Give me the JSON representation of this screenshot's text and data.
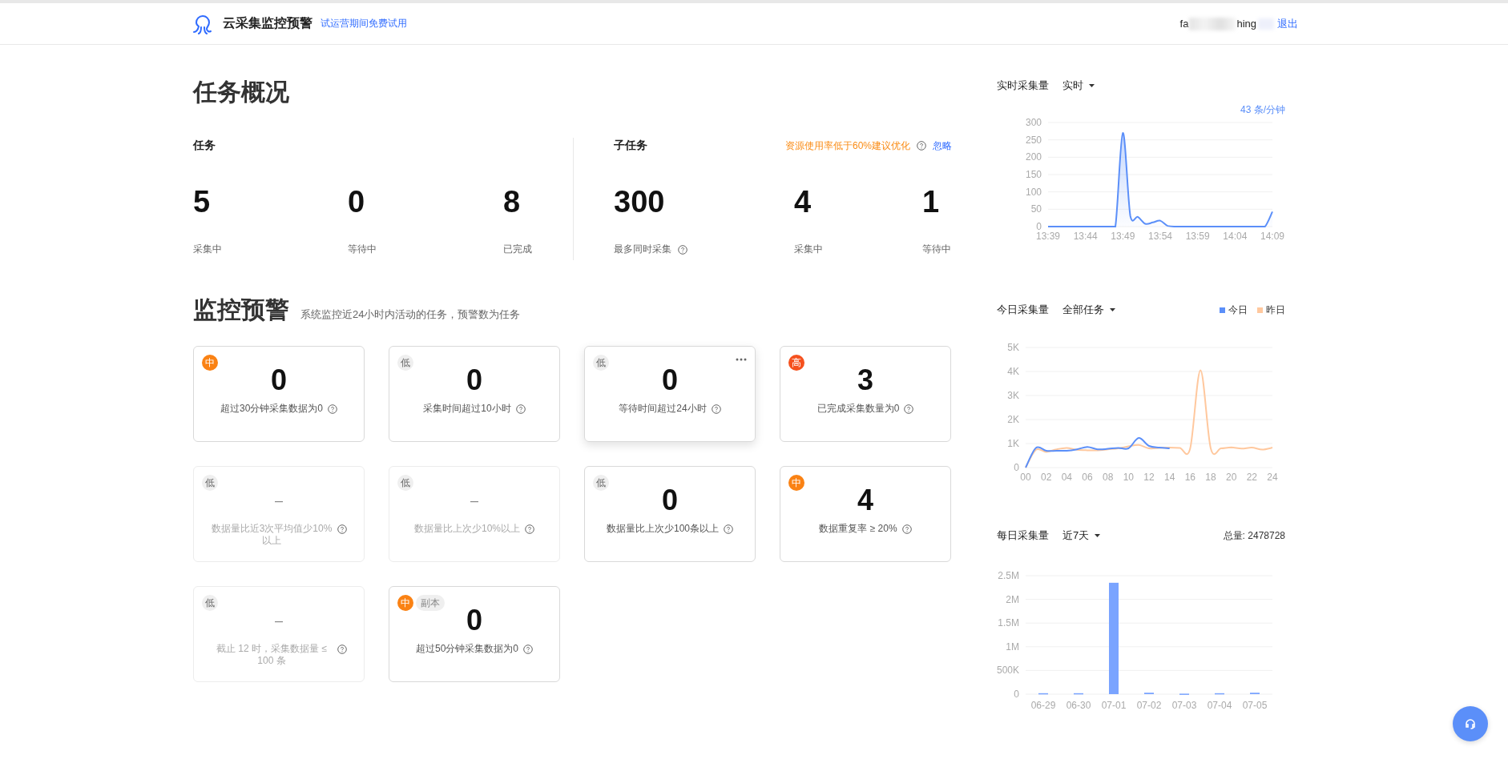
{
  "header": {
    "title": "云采集监控预警",
    "trial_note": "试运营期间免费试用",
    "username_start": "fa",
    "username_end": "hing",
    "logout": "退出"
  },
  "overview": {
    "title": "任务概况",
    "tasks": {
      "label": "任务",
      "stats": [
        {
          "value": "5",
          "label": "采集中",
          "help": false
        },
        {
          "value": "0",
          "label": "等待中",
          "help": false
        },
        {
          "value": "8",
          "label": "已完成",
          "help": false
        }
      ]
    },
    "subtasks": {
      "label": "子任务",
      "notice": "资源使用率低于60%建议优化",
      "ignore": "忽略",
      "stats": [
        {
          "value": "300",
          "label": "最多同时采集",
          "help": true
        },
        {
          "value": "4",
          "label": "采集中",
          "help": false
        },
        {
          "value": "1",
          "label": "等待中",
          "help": false
        }
      ]
    }
  },
  "monitor": {
    "title": "监控预警",
    "subtitle": "系统监控近24小时内活动的任务，预警数为任务",
    "cards": [
      {
        "severity": "中",
        "kind": "medium",
        "value": "0",
        "desc": "超过30分钟采集数据为0",
        "disabled": false,
        "hovered": false
      },
      {
        "severity": "低",
        "kind": "low",
        "value": "0",
        "desc": "采集时间超过10小时",
        "disabled": false,
        "hovered": false
      },
      {
        "severity": "低",
        "kind": "low",
        "value": "0",
        "desc": "等待时间超过24小时",
        "disabled": false,
        "hovered": true
      },
      {
        "severity": "高",
        "kind": "high",
        "value": "3",
        "desc": "已完成采集数量为0",
        "disabled": false,
        "hovered": false
      },
      {
        "severity": "低",
        "kind": "low",
        "value": "–",
        "desc": "数据量比近3次平均值少10%以上",
        "disabled": true,
        "hovered": false
      },
      {
        "severity": "低",
        "kind": "low",
        "value": "–",
        "desc": "数据量比上次少10%以上",
        "disabled": true,
        "hovered": false
      },
      {
        "severity": "低",
        "kind": "low",
        "value": "0",
        "desc": "数据量比上次少100条以上",
        "disabled": false,
        "hovered": false
      },
      {
        "severity": "中",
        "kind": "medium",
        "value": "4",
        "desc": "数据重复率 ≥ 20%",
        "disabled": false,
        "hovered": false
      },
      {
        "severity": "低",
        "kind": "low",
        "value": "–",
        "desc": "截止 12 时，采集数据量 ≤ 100 条",
        "disabled": true,
        "hovered": false
      },
      {
        "severity": "中",
        "kind": "medium",
        "tag": "副本",
        "value": "0",
        "desc": "超过50分钟采集数据为0",
        "disabled": false,
        "hovered": false
      }
    ]
  },
  "realtime": {
    "title": "实时采集量",
    "filter": "实时",
    "rate": "43 条/分钟",
    "chart_data": {
      "type": "area",
      "categories": [
        "13:39",
        null,
        null,
        null,
        null,
        "13:44",
        null,
        null,
        null,
        null,
        "13:49",
        null,
        null,
        null,
        null,
        "13:54",
        null,
        null,
        null,
        null,
        "13:59",
        null,
        null,
        null,
        null,
        "14:04",
        null,
        null,
        null,
        null,
        "14:09"
      ],
      "series": [
        {
          "color": "#5b8ff9",
          "values": [
            0,
            0,
            0,
            0,
            0,
            0,
            0,
            0,
            0,
            0,
            270,
            30,
            28,
            8,
            12,
            17,
            2,
            0,
            0,
            0,
            0,
            0,
            0,
            0,
            0,
            0,
            0,
            0,
            0,
            0,
            43
          ]
        }
      ],
      "ylim": [
        0,
        300
      ],
      "grid": true,
      "yticks": [
        0,
        50,
        100,
        150,
        200,
        250,
        300
      ]
    }
  },
  "today": {
    "title": "今日采集量",
    "filter": "全部任务",
    "chart_data": {
      "type": "line",
      "x": [
        0,
        1,
        2,
        3,
        4,
        5,
        6,
        7,
        8,
        9,
        10,
        11,
        12,
        13,
        14,
        15,
        16,
        17,
        18,
        19,
        20,
        21,
        22,
        23,
        24
      ],
      "series": [
        {
          "name": "今日",
          "color": "#5b8ff9",
          "values": [
            0,
            820,
            700,
            700,
            700,
            760,
            860,
            760,
            780,
            820,
            800,
            1230,
            900,
            830,
            800,
            null,
            null,
            null,
            null,
            null,
            null,
            null,
            null,
            null,
            null
          ]
        },
        {
          "name": "昨日",
          "color": "#ffc89e",
          "values": [
            0,
            740,
            650,
            760,
            820,
            740,
            720,
            720,
            760,
            800,
            880,
            940,
            800,
            820,
            830,
            820,
            790,
            4050,
            800,
            800,
            840,
            790,
            830,
            750,
            830
          ]
        }
      ],
      "xlim": [
        0,
        24
      ],
      "ylim": [
        0,
        5000
      ],
      "grid": true,
      "xticks": [
        {
          "value": 0,
          "label": "00"
        },
        {
          "value": 2,
          "label": "02"
        },
        {
          "value": 4,
          "label": "04"
        },
        {
          "value": 6,
          "label": "06"
        },
        {
          "value": 8,
          "label": "08"
        },
        {
          "value": 10,
          "label": "10"
        },
        {
          "value": 12,
          "label": "12"
        },
        {
          "value": 14,
          "label": "14"
        },
        {
          "value": 16,
          "label": "16"
        },
        {
          "value": 18,
          "label": "18"
        },
        {
          "value": 20,
          "label": "20"
        },
        {
          "value": 22,
          "label": "22"
        },
        {
          "value": 24,
          "label": "24"
        }
      ],
      "yticks": [
        {
          "value": 0,
          "label": "0"
        },
        {
          "value": 1000,
          "label": "1K"
        },
        {
          "value": 2000,
          "label": "2K"
        },
        {
          "value": 3000,
          "label": "3K"
        },
        {
          "value": 4000,
          "label": "4K"
        },
        {
          "value": 5000,
          "label": "5K"
        }
      ]
    }
  },
  "daily": {
    "title": "每日采集量",
    "filter": "近7天",
    "total": "总量: 2478728",
    "chart_data": {
      "type": "bar",
      "categories": [
        "06-29",
        "06-30",
        "07-01",
        "07-02",
        "07-03",
        "07-04",
        "07-05"
      ],
      "series": [
        {
          "color": "#7aa4ff",
          "values": [
            20000,
            20000,
            2350000,
            30000,
            10000,
            20000,
            30000
          ]
        }
      ],
      "ylim": [
        0,
        2500000
      ],
      "grid": true,
      "yticks": [
        {
          "value": 0,
          "label": "0"
        },
        {
          "value": 500000,
          "label": "500K"
        },
        {
          "value": 1000000,
          "label": "1M"
        },
        {
          "value": 1500000,
          "label": "1.5M"
        },
        {
          "value": 2000000,
          "label": "2M"
        },
        {
          "value": 2500000,
          "label": "2.5M"
        }
      ]
    }
  }
}
